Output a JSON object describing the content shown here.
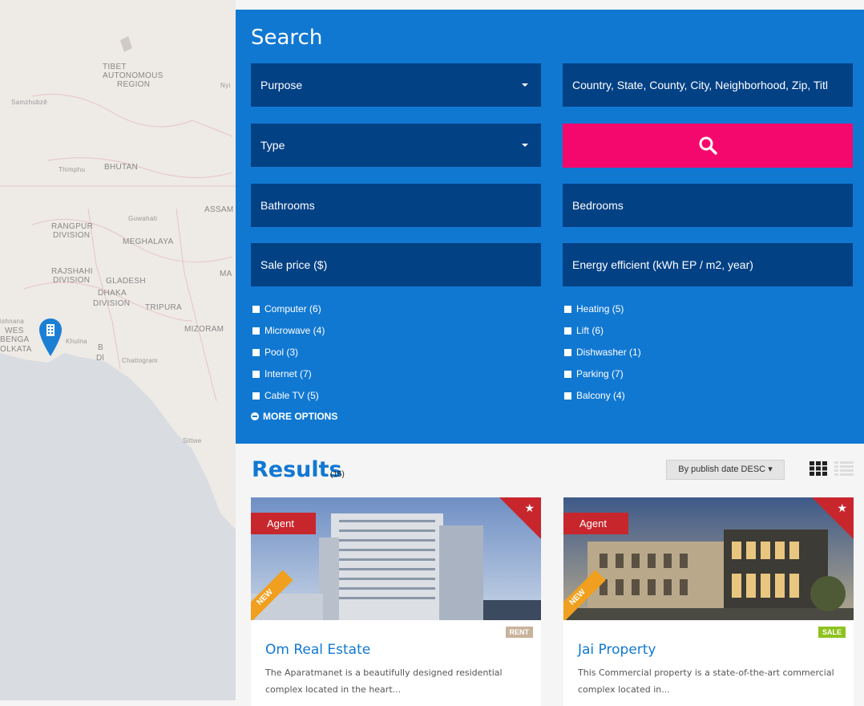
{
  "map": {
    "labels": [
      "TIBET",
      "AUTONOMOUS",
      "REGION",
      "Samzhubzê",
      "Nyi",
      "Thimphu",
      "BHUTAN",
      "ASSAM",
      "Guwahati",
      "RANGPUR",
      "DIVISION",
      "MEGHALAYA",
      "RAJSHAHI",
      "DIVISION",
      "GLADESH",
      "DHAKA",
      "DIVISION",
      "TRIPURA",
      "MA",
      "MIZORAM",
      "ishnana",
      "WES",
      "BENGA",
      "OLKATA",
      "Khulna",
      "B",
      "Dl",
      "Chattogram",
      "Sittwe"
    ]
  },
  "search": {
    "title": "Search",
    "purpose": "Purpose",
    "type": "Type",
    "location_placeholder": "Country, State, County, City, Neighborhood, Zip, Titl",
    "bathrooms": "Bathrooms",
    "bedrooms": "Bedrooms",
    "sale_price": "Sale price ($)",
    "energy": "Energy efficient (kWh EP / m2, year)",
    "search_icon": "search-icon",
    "amenities_left": [
      "Computer (6)",
      "Microwave (4)",
      "Pool (3)",
      "Internet (7)",
      "Cable TV (5)"
    ],
    "amenities_right": [
      "Heating (5)",
      "Lift (6)",
      "Dishwasher (1)",
      "Parking (7)",
      "Balcony (4)"
    ],
    "more_options": "MORE OPTIONS"
  },
  "results": {
    "title": "Results",
    "count": "(15)",
    "sort": "By publish date DESC",
    "listings": [
      {
        "badge": "Agent",
        "ribbon": "NEW",
        "tag": "RENT",
        "tag_color": "#c9b29b",
        "title": "Om Real Estate",
        "desc": "The Aparatmanet is a beautifully designed residential complex located in the heart..."
      },
      {
        "badge": "Agent",
        "ribbon": "NEW",
        "tag": "SALE",
        "tag_color": "#8dc21f",
        "title": "Jai Property",
        "desc": "This Commercial property is a state-of-the-art commercial complex located in..."
      }
    ]
  },
  "colors": {
    "primary": "#1178d2",
    "field": "#034185",
    "search_button": "#f5086d",
    "featured": "#c8262d",
    "new_ribbon": "#f0a01e"
  }
}
